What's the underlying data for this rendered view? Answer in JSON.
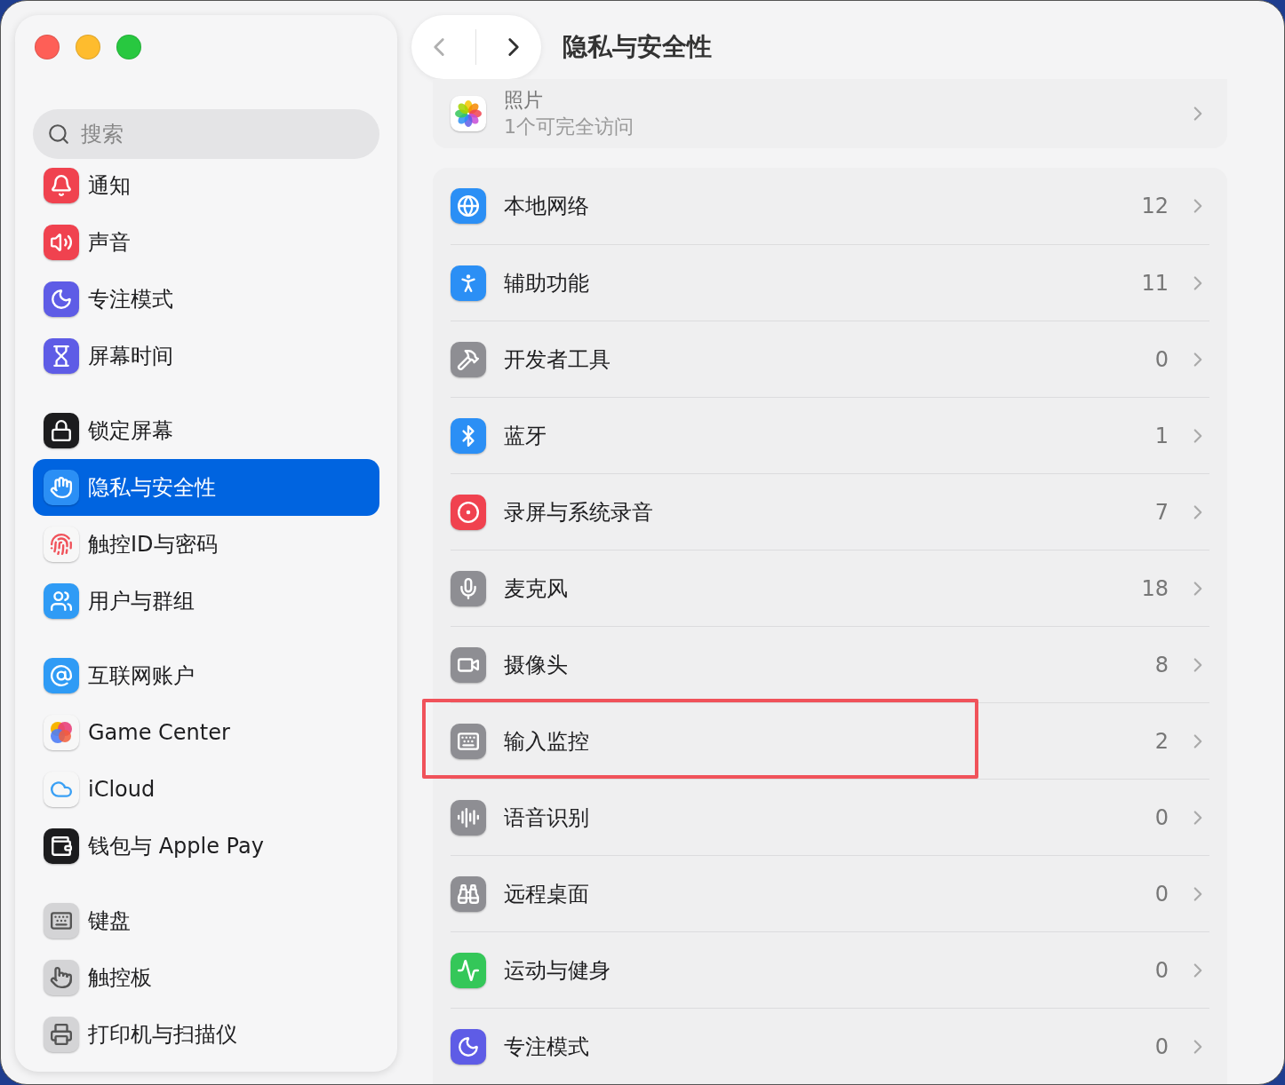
{
  "sidebar": {
    "search": {
      "placeholder": "搜索"
    },
    "groups": [
      {
        "items": [
          {
            "label": "通知",
            "color": "#f0424f",
            "selected": false
          },
          {
            "label": "声音",
            "color": "#f0424f",
            "selected": false
          },
          {
            "label": "专注模式",
            "color": "#5e5ce6",
            "selected": false
          },
          {
            "label": "屏幕时间",
            "color": "#5e5ce6",
            "selected": false
          }
        ]
      },
      {
        "items": [
          {
            "label": "锁定屏幕",
            "color": "#1c1c1e",
            "selected": false
          },
          {
            "label": "隐私与安全性",
            "color": "#2b8ff5",
            "selected": true
          },
          {
            "label": "触控ID与密码",
            "color": "#f7f7f7",
            "selected": false
          },
          {
            "label": "用户与群组",
            "color": "#2f9bf5",
            "selected": false
          }
        ]
      },
      {
        "items": [
          {
            "label": "互联网账户",
            "color": "#2f9bf5",
            "selected": false
          },
          {
            "label": "Game Center",
            "color": "#f7f7f7",
            "selected": false
          },
          {
            "label": "iCloud",
            "color": "#f7f7f7",
            "selected": false
          },
          {
            "label": "钱包与 Apple Pay",
            "color": "#1c1c1e",
            "selected": false
          }
        ]
      },
      {
        "items": [
          {
            "label": "键盘",
            "color": "#d4d4d6",
            "selected": false
          },
          {
            "label": "触控板",
            "color": "#d4d4d6",
            "selected": false
          },
          {
            "label": "打印机与扫描仪",
            "color": "#d4d4d6",
            "selected": false
          }
        ]
      }
    ]
  },
  "toolbar": {
    "back": {
      "disabled": true
    },
    "forward": {
      "disabled": false
    },
    "title": "隐私与安全性"
  },
  "photos": {
    "label": "照片",
    "detail": "1个可完全访问"
  },
  "permissions": [
    {
      "label": "本地网络",
      "count": "12",
      "color": "#2b8ff5",
      "highlighted": false
    },
    {
      "label": "辅助功能",
      "count": "11",
      "color": "#2b8ff5",
      "highlighted": false
    },
    {
      "label": "开发者工具",
      "count": "0",
      "color": "#8e8e93",
      "highlighted": false
    },
    {
      "label": "蓝牙",
      "count": "1",
      "color": "#2b8ff5",
      "highlighted": false
    },
    {
      "label": "录屏与系统录音",
      "count": "7",
      "color": "#f0424f",
      "highlighted": false
    },
    {
      "label": "麦克风",
      "count": "18",
      "color": "#8e8e93",
      "highlighted": false
    },
    {
      "label": "摄像头",
      "count": "8",
      "color": "#8e8e93",
      "highlighted": false
    },
    {
      "label": "输入监控",
      "count": "2",
      "color": "#8e8e93",
      "highlighted": true
    },
    {
      "label": "语音识别",
      "count": "0",
      "color": "#8e8e93",
      "highlighted": false
    },
    {
      "label": "远程桌面",
      "count": "0",
      "color": "#8e8e93",
      "highlighted": false
    },
    {
      "label": "运动与健身",
      "count": "0",
      "color": "#34c759",
      "highlighted": false
    },
    {
      "label": "专注模式",
      "count": "0",
      "color": "#5e5ce6",
      "highlighted": false
    }
  ]
}
